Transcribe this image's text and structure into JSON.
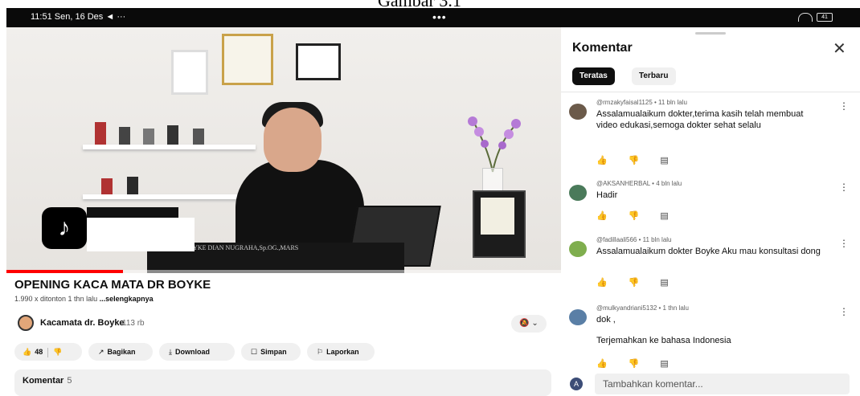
{
  "caption": "Gambar 3.1",
  "status_bar": {
    "time": "11:51  Sen, 16 Des",
    "extra": "◄ ···",
    "center": "•••",
    "battery": "41"
  },
  "video": {
    "desk_text": "dr.H.BOYKE DIAN NUGRAHA,Sp.OG.,MARS",
    "progress_fraction": 0.21
  },
  "info": {
    "title": "OPENING KACA MATA DR BOYKE",
    "meta": "1.990 x ditonton  1 thn lalu",
    "more": "...selengkapnya",
    "channel": "Kacamata dr. Boyke",
    "subs": "113 rb",
    "bell": "🔕 ⌄"
  },
  "actions": {
    "like_icon": "👍",
    "like_count": "48",
    "dislike_icon": "👎",
    "share": "Bagikan",
    "download": "Download",
    "save": "Simpan",
    "report": "Laporkan"
  },
  "comments_box": {
    "label": "Komentar",
    "count": "5"
  },
  "panel": {
    "title": "Komentar",
    "close": "✕",
    "chip_top": "Teratas",
    "chip_new": "Terbaru",
    "comments": [
      {
        "author_meta": "@rmzakyfaisal1125 • 11 bln lalu",
        "text": "Assalamualaikum dokter,terima kasih telah membuat video edukasi,semoga dokter sehat selalu",
        "avatar_color": "#6b5a4a"
      },
      {
        "author_meta": "@AKSANHERBAL • 4 bln lalu",
        "text": "Hadir",
        "avatar_color": "#4a7a5a"
      },
      {
        "author_meta": "@fadillaali566 • 11 bln lalu",
        "text": "Assalamualaikum dokter Boyke Aku mau konsultasi dong",
        "avatar_color": "#7fae4e"
      },
      {
        "author_meta": "@mulkyandriani5132 • 1 thn lalu",
        "text": "dok ,",
        "translate": "Terjemahkan ke bahasa Indonesia",
        "avatar_color": "#5a7fa6"
      }
    ],
    "icons": {
      "like": "👍",
      "dislike": "👎",
      "reply": "▤",
      "more": "⋮"
    },
    "add_avatar": "A",
    "add_placeholder": "Tambahkan komentar..."
  }
}
